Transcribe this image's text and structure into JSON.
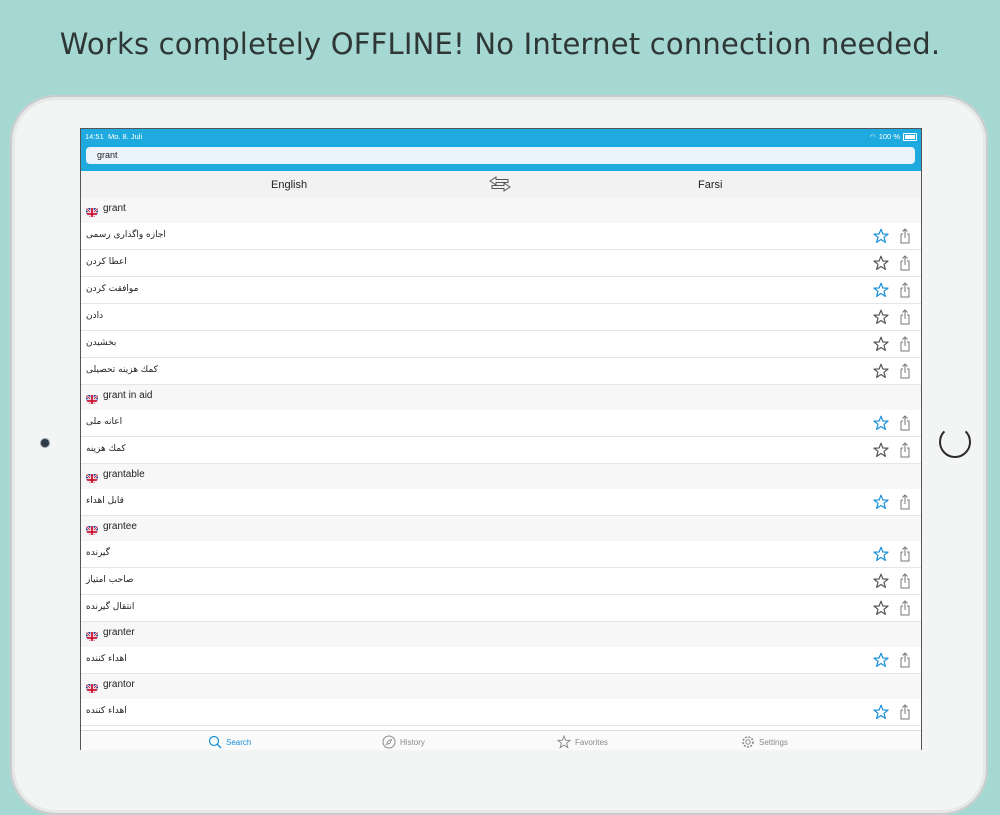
{
  "headline": "Works completely OFFLINE! No Internet connection needed.",
  "status": {
    "time": "14:51",
    "date": "Mo. 8. Juli",
    "battery": "100 %"
  },
  "search": {
    "value": "grant"
  },
  "languages": {
    "source": "English",
    "target": "Farsi"
  },
  "colors": {
    "accent": "#1eaadf",
    "active_tab": "#1a8fd8",
    "background": "#a5d8d2"
  },
  "entries": [
    {
      "word": "grant",
      "translations": [
        {
          "text": "اجازه واگذاری رسمی",
          "favorite": true
        },
        {
          "text": "اعطا کردن",
          "favorite": false
        },
        {
          "text": "موافقت کردن",
          "favorite": true
        },
        {
          "text": "دادن",
          "favorite": false
        },
        {
          "text": "بخشیدن",
          "favorite": false
        },
        {
          "text": "کمك هزینه تحصیلی",
          "favorite": false
        }
      ]
    },
    {
      "word": "grant in aid",
      "translations": [
        {
          "text": "اعانه ملی",
          "favorite": true
        },
        {
          "text": "کمك هزینه",
          "favorite": false
        }
      ]
    },
    {
      "word": "grantable",
      "translations": [
        {
          "text": "قابل اهداء",
          "favorite": true
        }
      ]
    },
    {
      "word": "grantee",
      "translations": [
        {
          "text": "گیرنده",
          "favorite": true
        },
        {
          "text": "صاحب امتیاز",
          "favorite": false
        },
        {
          "text": "انتقال گیرنده",
          "favorite": false
        }
      ]
    },
    {
      "word": "granter",
      "translations": [
        {
          "text": "اهداء کننده",
          "favorite": true
        }
      ]
    },
    {
      "word": "grantor",
      "translations": [
        {
          "text": "اهداء کننده",
          "favorite": true
        }
      ]
    }
  ],
  "tabs": [
    {
      "label": "Search",
      "icon": "search-icon",
      "active": true
    },
    {
      "label": "History",
      "icon": "compass-icon",
      "active": false
    },
    {
      "label": "Favorites",
      "icon": "star-icon",
      "active": false
    },
    {
      "label": "Settings",
      "icon": "gear-icon",
      "active": false
    }
  ]
}
